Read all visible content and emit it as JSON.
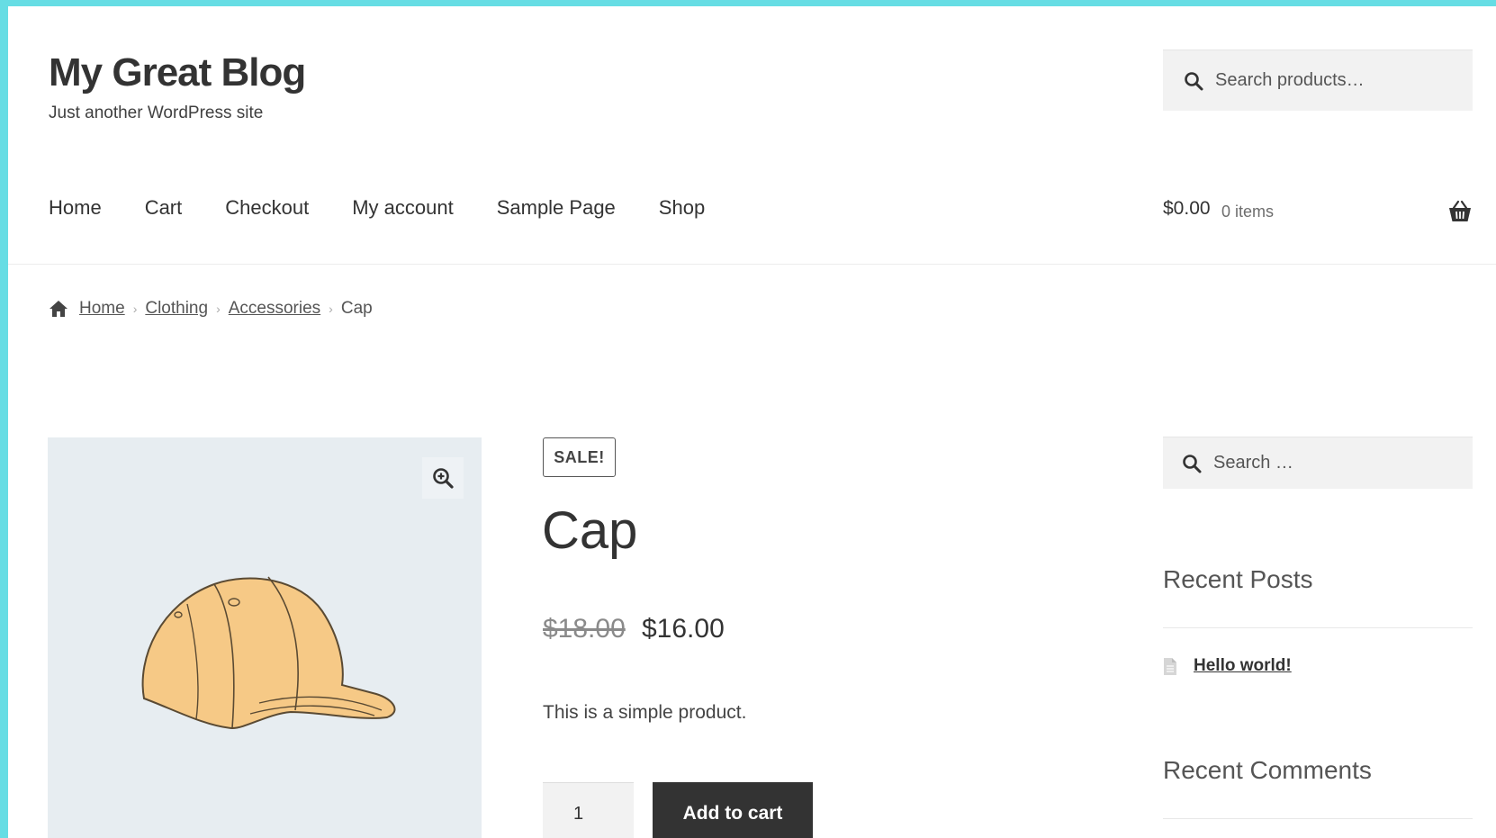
{
  "site": {
    "title": "My Great Blog",
    "tagline": "Just another WordPress site"
  },
  "header_search": {
    "placeholder": "Search products…",
    "icon": "search-icon"
  },
  "nav": {
    "items": [
      {
        "label": "Home"
      },
      {
        "label": "Cart"
      },
      {
        "label": "Checkout"
      },
      {
        "label": "My account"
      },
      {
        "label": "Sample Page"
      },
      {
        "label": "Shop"
      }
    ]
  },
  "cart": {
    "total": "$0.00",
    "count": "0 items",
    "icon": "basket-icon"
  },
  "breadcrumb": {
    "icon": "home-icon",
    "items": [
      "Home",
      "Clothing",
      "Accessories"
    ],
    "current": "Cap"
  },
  "product": {
    "badge": "SALE!",
    "title": "Cap",
    "price_old": "$18.00",
    "price_new": "$16.00",
    "description": "This is a simple product.",
    "quantity": "1",
    "add_to_cart_label": "Add to cart",
    "image_icon": "zoom-in-icon"
  },
  "sidebar": {
    "search_placeholder": "Search …",
    "recent_posts_title": "Recent Posts",
    "recent_posts": [
      "Hello world!"
    ],
    "recent_comments_title": "Recent Comments"
  },
  "colors": {
    "frame": "#66dde4",
    "button": "#333333",
    "gallery_bg": "#e7edf1",
    "cap_fill": "#f6c986"
  }
}
